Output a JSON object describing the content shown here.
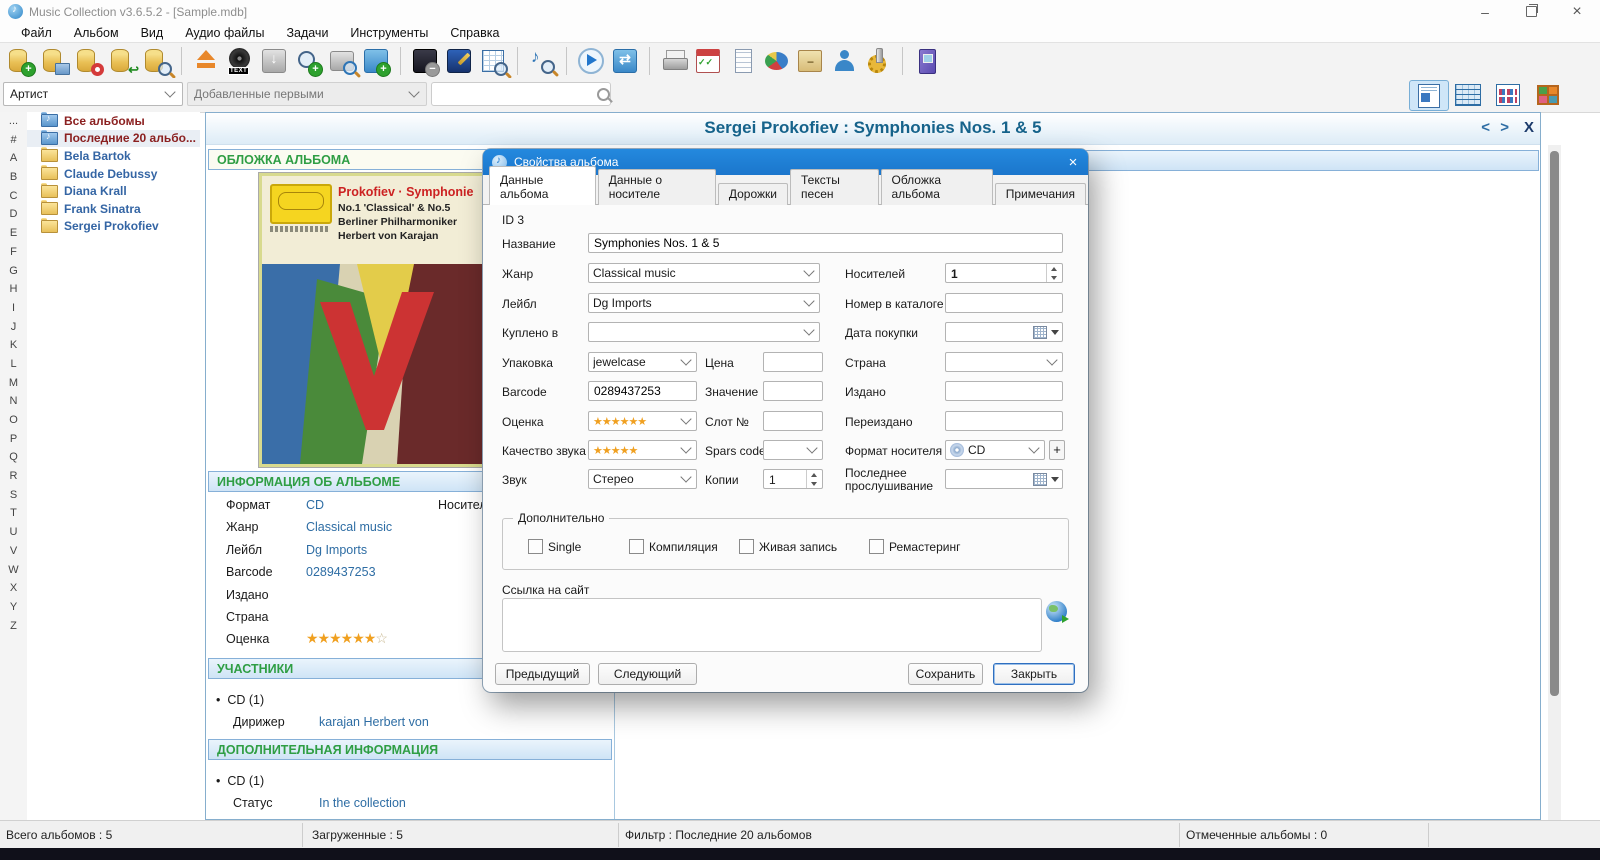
{
  "titlebar": {
    "title": "Music Collection v3.6.5.2 - [Sample.mdb]"
  },
  "menu": {
    "items": [
      "Файл",
      "Альбом",
      "Вид",
      "Аудио файлы",
      "Задачи",
      "Инструменты",
      "Справка"
    ]
  },
  "toolbar": {
    "icons": [
      "add-database",
      "open-database",
      "backup-database",
      "restore-database",
      "repair-database",
      "eject-cd",
      "read-cd-text",
      "download-album-data",
      "search-and-add",
      "scan-devices",
      "add-album",
      "remove-album",
      "edit-album",
      "browse-albums-table",
      "search-music",
      "play",
      "random-play",
      "print",
      "tasks",
      "reports",
      "statistics",
      "card-file",
      "borrowers",
      "preferences",
      "exit"
    ]
  },
  "filterbar": {
    "group_by": "Артист",
    "sort_order": "Добавленные первыми",
    "search_value": ""
  },
  "alphabet": [
    "...",
    "#",
    "A",
    "B",
    "C",
    "D",
    "E",
    "F",
    "G",
    "H",
    "I",
    "J",
    "K",
    "L",
    "M",
    "N",
    "O",
    "P",
    "Q",
    "R",
    "S",
    "T",
    "U",
    "V",
    "W",
    "X",
    "Y",
    "Z"
  ],
  "sidebar": {
    "items": [
      {
        "label": "Все альбомы"
      },
      {
        "label": "Последние 20 альбо..."
      },
      {
        "label": "Bela Bartok"
      },
      {
        "label": "Claude Debussy"
      },
      {
        "label": "Diana Krall"
      },
      {
        "label": "Frank Sinatra"
      },
      {
        "label": "Sergei Prokofiev"
      }
    ]
  },
  "main": {
    "title": "Sergei Prokofiev : Symphonies Nos. 1 & 5",
    "nav_prev": "<",
    "nav_next": ">",
    "nav_close": "X"
  },
  "cover_section": {
    "header": "ОБЛОЖКА АЛЬБОМА",
    "art_title": "Prokofiev · Symphonie",
    "art_line1": "No.1 'Classical' & No.5",
    "art_line2": "Berliner Philharmoniker",
    "art_line3": "Herbert von Karajan"
  },
  "info_section": {
    "header": "ИНФОРМАЦИЯ ОБ АЛЬБОМЕ",
    "col2_label": "Носителей",
    "rows": [
      {
        "label": "Формат",
        "value": "CD"
      },
      {
        "label": "Жанр",
        "value": "Classical music"
      },
      {
        "label": "Лейбл",
        "value": "Dg Imports"
      },
      {
        "label": "Barcode",
        "value": "0289437253"
      },
      {
        "label": "Издано",
        "value": ""
      },
      {
        "label": "Страна",
        "value": ""
      }
    ],
    "rating_label": "Оценка",
    "rating_filled": "★★★★★★",
    "rating_empty": "☆"
  },
  "participants_section": {
    "header": "УЧАСТНИКИ",
    "group": "CD (1)",
    "row": {
      "label": "Дирижер",
      "value": "karajan Herbert von"
    }
  },
  "extra_section": {
    "header": "ДОПОЛНИТЕЛЬНАЯ ИНФОРМАЦИЯ",
    "group": "CD (1)",
    "row": {
      "label": "Статус",
      "value": "In the collection"
    }
  },
  "dialog": {
    "title": "Свойства альбома",
    "tabs": [
      "Данные альбома",
      "Данные о носителе",
      "Дорожки",
      "Тексты песен",
      "Обложка альбома",
      "Примечания"
    ],
    "id_label": "ID 3",
    "fields": {
      "title": {
        "label": "Название",
        "value": "Symphonies Nos. 1 & 5"
      },
      "genre": {
        "label": "Жанр",
        "value": "Classical music"
      },
      "label": {
        "label": "Лейбл",
        "value": "Dg Imports"
      },
      "bought_at": {
        "label": "Куплено в",
        "value": ""
      },
      "packaging": {
        "label": "Упаковка",
        "value": "jewelcase"
      },
      "barcode": {
        "label": "Barcode",
        "value": "0289437253"
      },
      "rating": {
        "label": "Оценка",
        "stars": "★★★★★★"
      },
      "sound_quality": {
        "label": "Качество звука",
        "stars": "★★★★★"
      },
      "sound": {
        "label": "Звук",
        "value": "Стерео"
      },
      "price": {
        "label": "Цена",
        "value": ""
      },
      "value": {
        "label": "Значение",
        "value": ""
      },
      "slot": {
        "label": "Слот №",
        "value": ""
      },
      "spars": {
        "label": "Spars code",
        "value": ""
      },
      "copies": {
        "label": "Копии",
        "value": "1"
      },
      "media_count": {
        "label": "Носителей",
        "value": "1"
      },
      "catalog_number": {
        "label": "Номер в каталоге",
        "value": ""
      },
      "purchase_date": {
        "label": "Дата покупки",
        "value": ""
      },
      "country": {
        "label": "Страна",
        "value": ""
      },
      "released": {
        "label": "Издано",
        "value": ""
      },
      "reissued": {
        "label": "Переиздано",
        "value": ""
      },
      "media_format": {
        "label": "Формат носителя",
        "value": "CD",
        "add_button": "+"
      },
      "last_listen": {
        "label": "Последнее прослушивание",
        "value": ""
      }
    },
    "extras_group": {
      "legend": "Дополнительно",
      "checkboxes": [
        "Single",
        "Компиляция",
        "Живая запись",
        "Ремастеринг"
      ]
    },
    "website": {
      "label": "Ссылка на сайт",
      "value": ""
    },
    "buttons": {
      "prev": "Предыдущий",
      "next": "Следующий",
      "save": "Сохранить",
      "close": "Закрыть"
    }
  },
  "statusbar": {
    "total": "Всего альбомов : 5",
    "loaded": "Загруженные : 5",
    "filter": "Фильтр : Последние 20 альбомов",
    "marked": "Отмеченные альбомы : 0"
  }
}
